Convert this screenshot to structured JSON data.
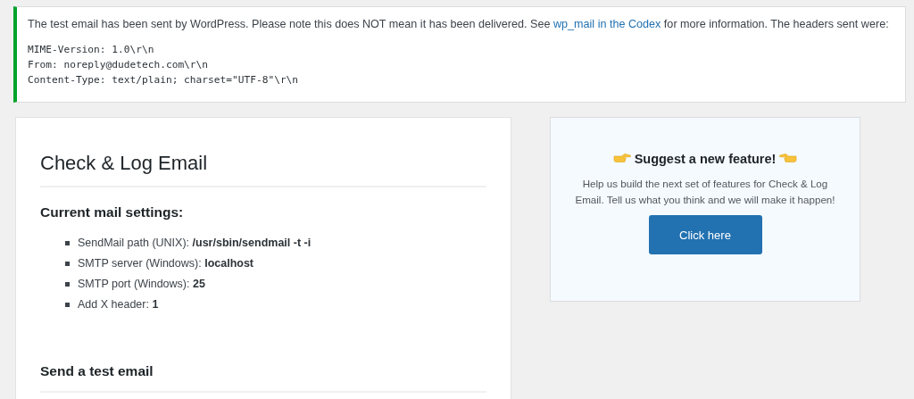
{
  "notice": {
    "text_before": "The test email has been sent by WordPress. Please note this does NOT mean it has been delivered. See ",
    "link": "wp_mail in the Codex",
    "text_after": " for more information. The headers sent were:",
    "headers": [
      "MIME-Version: 1.0\\r\\n",
      "From: noreply@dudetech.com\\r\\n",
      "Content-Type: text/plain; charset=\"UTF-8\"\\r\\n"
    ]
  },
  "main": {
    "title": "Check & Log Email",
    "settings_heading": "Current mail settings:",
    "settings": [
      "SendMail path (UNIX): **/usr/sbin/sendmail -t -i**",
      "SMTP server (Windows): **localhost**",
      "SMTP port (Windows): **25**",
      "Add X header: **1**"
    ],
    "test_heading": "Send a test email"
  },
  "promo": {
    "title": "Suggest a new feature!",
    "text": "Help us build the next set of features for Check & Log Email. Tell us what you think and we will make it happen!",
    "button": "Click here"
  }
}
